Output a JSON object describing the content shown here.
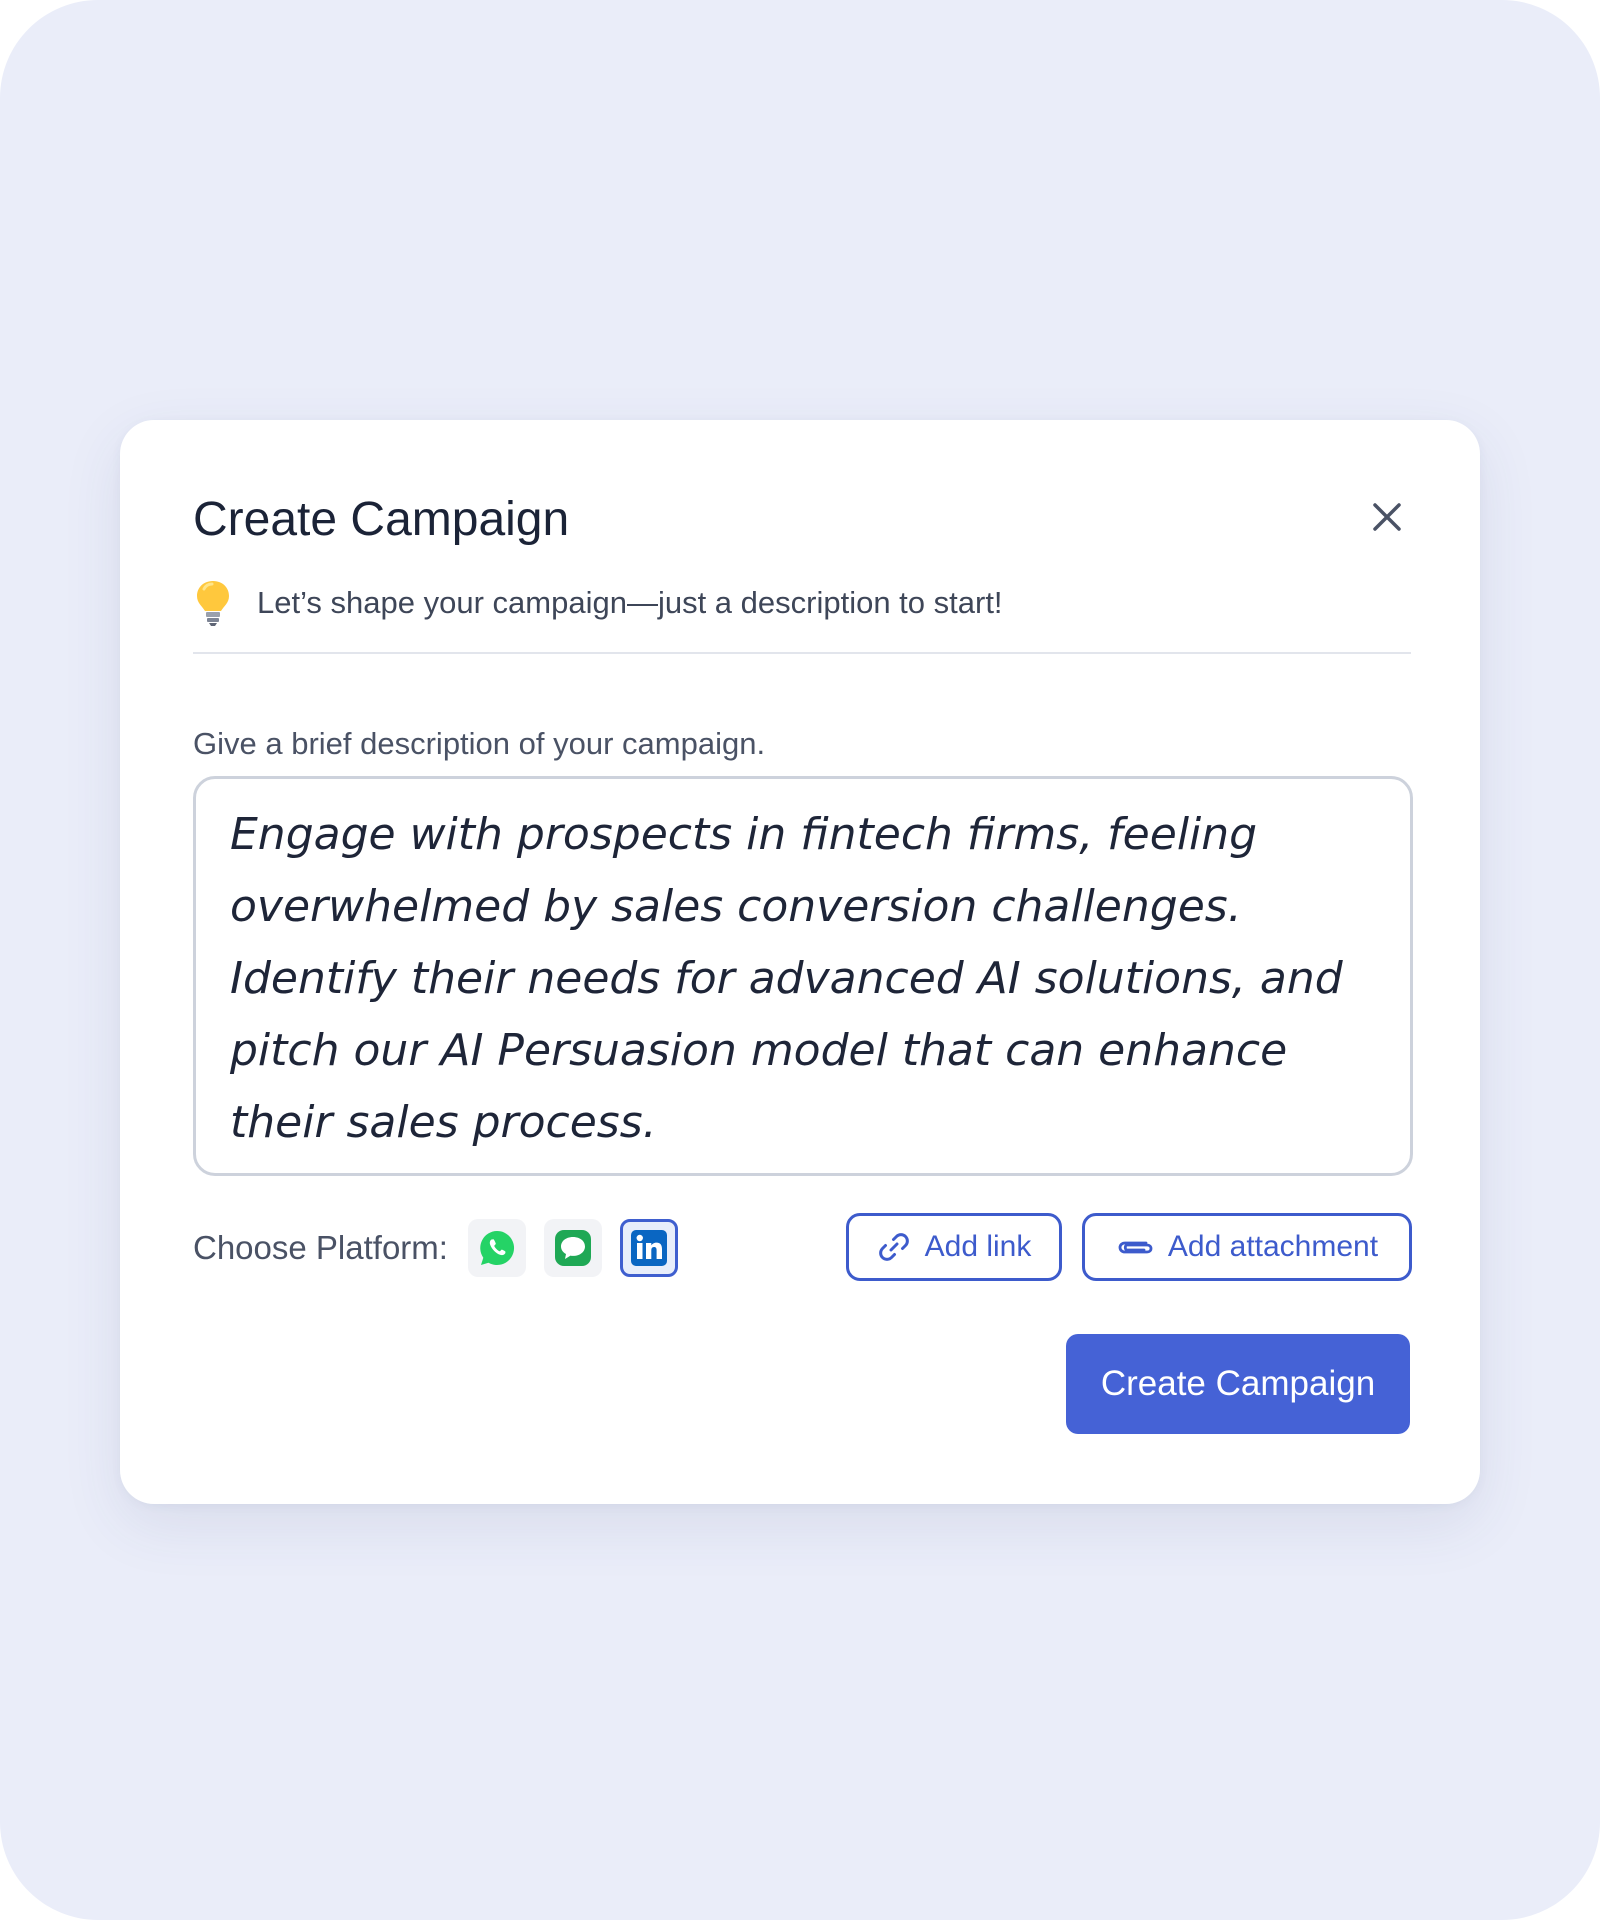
{
  "modal": {
    "title": "Create Campaign",
    "tip_text": "Let’s shape your campaign—just a description to start!",
    "tip_icon": "lightbulb-icon",
    "close_icon": "close-icon"
  },
  "description": {
    "label": "Give a brief description of your campaign.",
    "value": "Engage with prospects in fintech firms, feeling overwhelmed by sales conversion challenges. Identify their needs for advanced AI solutions, and pitch our AI Persuasion model that can enhance their sales process."
  },
  "platforms": {
    "label": "Choose Platform:",
    "options": [
      {
        "name": "WhatsApp",
        "icon": "whatsapp-icon",
        "selected": false,
        "color": "#25D366"
      },
      {
        "name": "Messages",
        "icon": "message-icon",
        "selected": false,
        "color": "#1FA855"
      },
      {
        "name": "LinkedIn",
        "icon": "linkedin-icon",
        "selected": true,
        "color": "#0A66C2"
      }
    ]
  },
  "actions": {
    "add_link": "Add link",
    "add_link_icon": "link-icon",
    "add_attachment": "Add attachment",
    "add_attachment_icon": "paperclip-icon",
    "submit": "Create Campaign"
  },
  "colors": {
    "background": "#EAEDF9",
    "accent": "#4562D6",
    "outline_accent": "#3D5BCC"
  }
}
